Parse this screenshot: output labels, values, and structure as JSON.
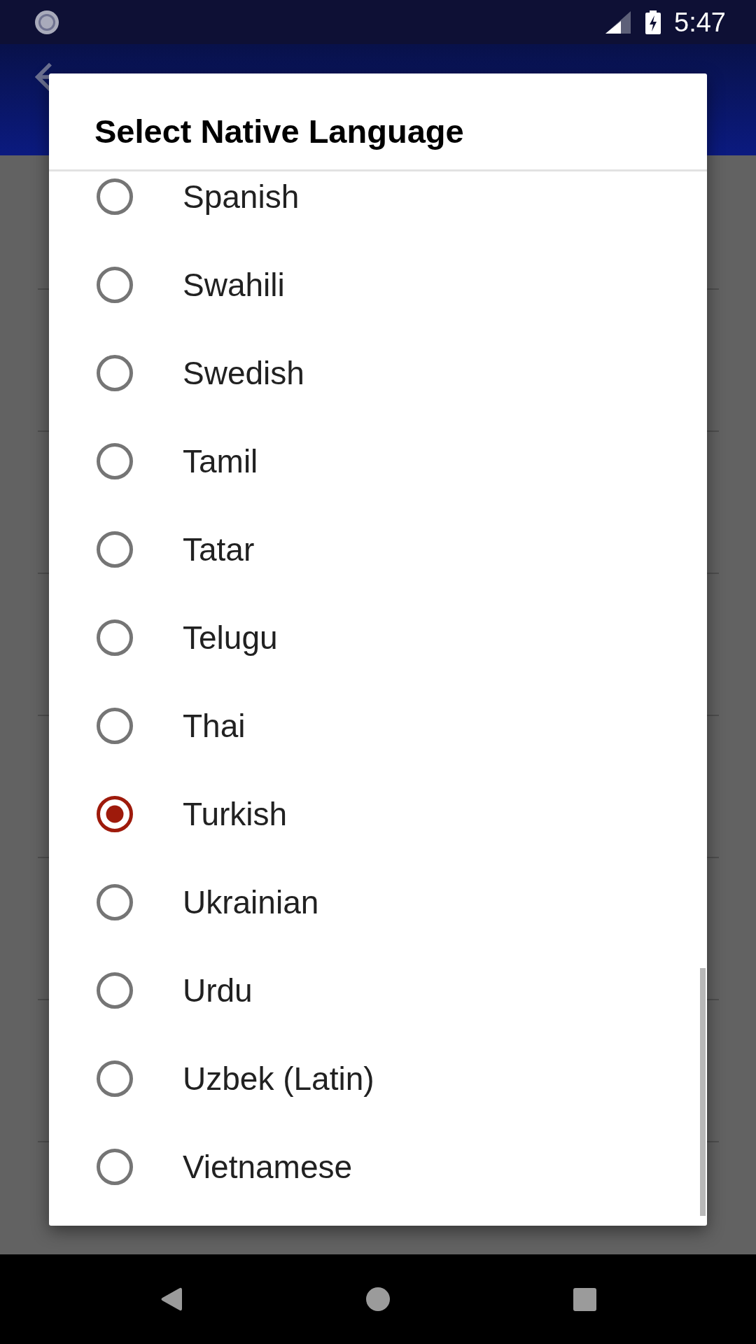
{
  "status_bar": {
    "time": "5:47"
  },
  "dialog": {
    "title": "Select Native Language",
    "options": [
      {
        "label": "Spanish",
        "selected": false
      },
      {
        "label": "Swahili",
        "selected": false
      },
      {
        "label": "Swedish",
        "selected": false
      },
      {
        "label": "Tamil",
        "selected": false
      },
      {
        "label": "Tatar",
        "selected": false
      },
      {
        "label": "Telugu",
        "selected": false
      },
      {
        "label": "Thai",
        "selected": false
      },
      {
        "label": "Turkish",
        "selected": true
      },
      {
        "label": "Ukrainian",
        "selected": false
      },
      {
        "label": "Urdu",
        "selected": false
      },
      {
        "label": "Uzbek (Latin)",
        "selected": false
      },
      {
        "label": "Vietnamese",
        "selected": false
      }
    ]
  }
}
